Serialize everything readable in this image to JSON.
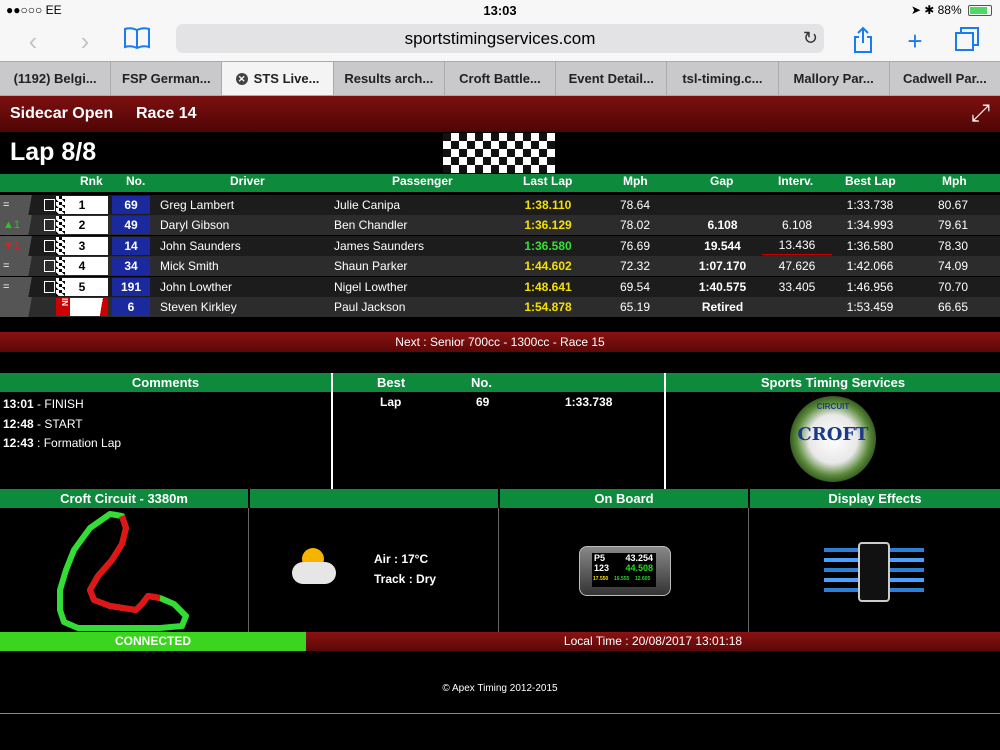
{
  "status": {
    "carrier": "●●○○○ EE",
    "time": "13:03",
    "battery": "88%"
  },
  "browser": {
    "url": "sportstimingservices.com"
  },
  "tabs": [
    {
      "label": "(1192) Belgi..."
    },
    {
      "label": "FSP German..."
    },
    {
      "label": "STS Live..."
    },
    {
      "label": "Results arch..."
    },
    {
      "label": "Croft Battle..."
    },
    {
      "label": "Event Detail..."
    },
    {
      "label": "tsl-timing.c..."
    },
    {
      "label": "Mallory Par..."
    },
    {
      "label": "Cadwell Par..."
    }
  ],
  "race": {
    "class": "Sidecar Open",
    "race": "Race 14",
    "lap": "Lap 8/8"
  },
  "columns": {
    "rnk": "Rnk",
    "no": "No.",
    "driver": "Driver",
    "passenger": "Passenger",
    "last_lap": "Last Lap",
    "mph": "Mph",
    "gap": "Gap",
    "interval": "Interv.",
    "best_lap": "Best Lap",
    "best_mph": "Mph"
  },
  "rows": [
    {
      "status": "=",
      "pos": "1",
      "no": "69",
      "driver": "Greg Lambert",
      "passenger": "Julie Canipa",
      "last": "1:38.110",
      "mph": "78.64",
      "gap": "",
      "interval": "",
      "best": "1:33.738",
      "bmph": "80.67"
    },
    {
      "status": "▲1",
      "pos": "2",
      "no": "49",
      "driver": "Daryl Gibson",
      "passenger": "Ben Chandler",
      "last": "1:36.129",
      "mph": "78.02",
      "gap": "6.108",
      "interval": "6.108",
      "best": "1:34.993",
      "bmph": "79.61"
    },
    {
      "status": "▼1",
      "pos": "3",
      "no": "14",
      "driver": "John Saunders",
      "passenger": "James Saunders",
      "last": "1:36.580",
      "mph": "76.69",
      "gap": "19.544",
      "interval": "13.436",
      "best": "1:36.580",
      "bmph": "78.30"
    },
    {
      "status": "=",
      "pos": "4",
      "no": "34",
      "driver": "Mick Smith",
      "passenger": "Shaun Parker",
      "last": "1:44.602",
      "mph": "72.32",
      "gap": "1:07.170",
      "interval": "47.626",
      "best": "1:42.066",
      "bmph": "74.09"
    },
    {
      "status": "=",
      "pos": "5",
      "no": "191",
      "driver": "John Lowther",
      "passenger": "Nigel Lowther",
      "last": "1:48.641",
      "mph": "69.54",
      "gap": "1:40.575",
      "interval": "33.405",
      "best": "1:46.956",
      "bmph": "70.70"
    },
    {
      "status": "",
      "pos": "IN",
      "no": "6",
      "driver": "Steven Kirkley",
      "passenger": "Paul Jackson",
      "last": "1:54.878",
      "mph": "65.19",
      "gap": "Retired",
      "interval": "",
      "best": "1:53.459",
      "bmph": "66.65"
    }
  ],
  "next": "Next : Senior 700cc - 1300cc - Race 15",
  "comments": {
    "title": "Comments",
    "items": [
      {
        "time": "13:01",
        "text": " - FINISH"
      },
      {
        "time": "12:48",
        "text": " - START"
      },
      {
        "time": "12:43",
        "text": " : Formation Lap"
      }
    ]
  },
  "best": {
    "title": "Best",
    "no_label": "No.",
    "kind": "Lap",
    "no": "69",
    "value": "1:33.738"
  },
  "sts_title": "Sports Timing Services",
  "croft_logo": {
    "top": "CIRCUIT",
    "name": "CROFT"
  },
  "circuit_title": "Croft Circuit - 3380m",
  "weather": {
    "air": "Air : 17°C",
    "track": "Track : Dry"
  },
  "onboard": {
    "title": "On Board",
    "p": "P5",
    "t1": "43.254",
    "n": "123",
    "t2": "44.508",
    "s1": "17.550",
    "s2": "16.555",
    "s3": "12.605"
  },
  "display_effects": "Display Effects",
  "connected": "CONNECTED",
  "local_time": "Local Time : 20/08/2017 13:01:18",
  "footer": "© Apex Timing 2012-2015"
}
